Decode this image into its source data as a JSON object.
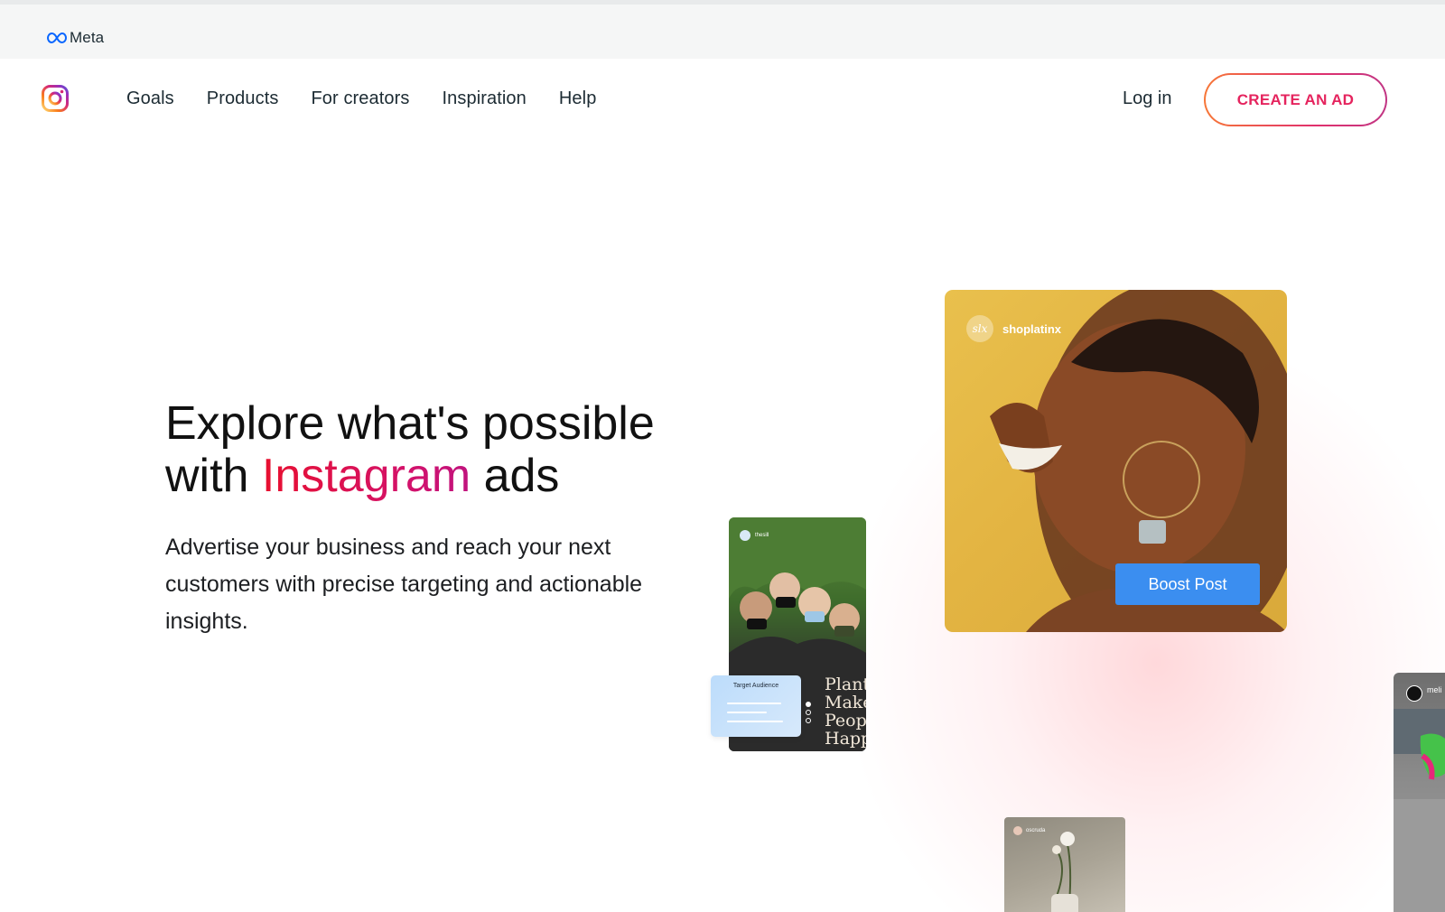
{
  "meta_bar": {
    "brand": "Meta"
  },
  "nav": {
    "links": [
      "Goals",
      "Products",
      "For creators",
      "Inspiration",
      "Help"
    ],
    "login": "Log in",
    "cta": "CREATE AN AD"
  },
  "hero": {
    "headline_part1": "Explore what's possible",
    "headline_part2_pre": "with ",
    "headline_accent": "Instagram",
    "headline_part2_post": " ads",
    "subtext": "Advertise your business and reach your next customers with precise targeting and actionable insights."
  },
  "cards": {
    "main": {
      "handle": "shoplatinx",
      "avatar_text": "slx",
      "button": "Boost Post"
    },
    "group": {
      "handle": "thesill",
      "shirt_text": "Plants\nMake\nPeople\nHappy"
    },
    "target": {
      "title": "Target Audience"
    },
    "flower": {
      "handle": "oscruda"
    },
    "edge": {
      "handle": "meli"
    }
  },
  "colors": {
    "cta_text": "#e5245e",
    "accent_start": "#e8102f",
    "accent_end": "#c0137e",
    "boost_button": "#3b8ef0"
  }
}
